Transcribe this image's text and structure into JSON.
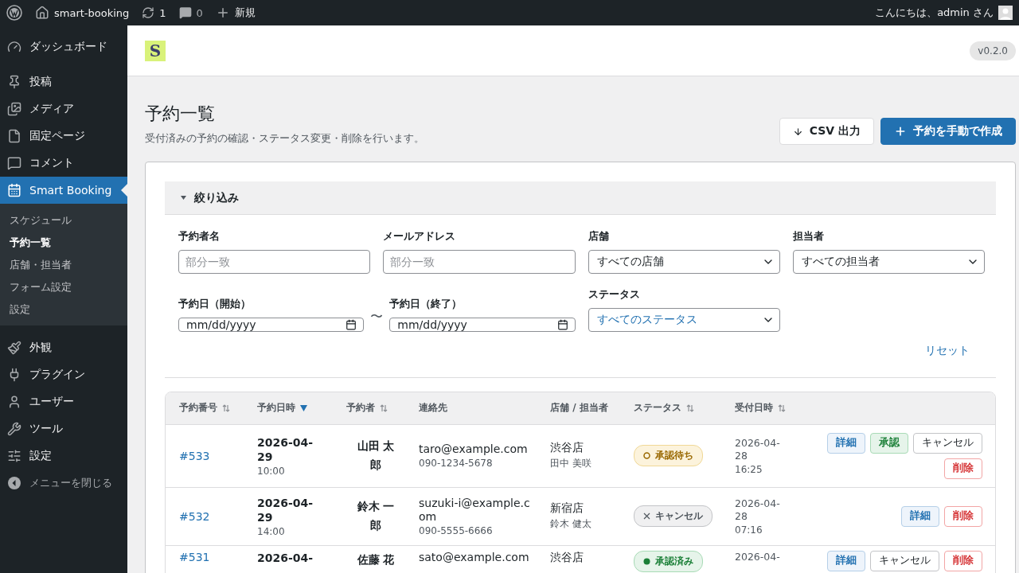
{
  "admin_bar": {
    "site": "smart-booking",
    "updates": "1",
    "comments": "0",
    "new": "新規",
    "greeting": "こんにちは、admin さん"
  },
  "sidebar": {
    "items": [
      {
        "label": "ダッシュボード",
        "selected": false
      },
      {
        "label": "投稿",
        "selected": false
      },
      {
        "label": "メディア",
        "selected": false
      },
      {
        "label": "固定ページ",
        "selected": false
      },
      {
        "label": "コメント",
        "selected": false
      },
      {
        "label": "Smart Booking",
        "selected": true,
        "children": [
          {
            "label": "スケジュール",
            "selected": false
          },
          {
            "label": "予約一覧",
            "selected": true
          },
          {
            "label": "店舗・担当者",
            "selected": false
          },
          {
            "label": "フォーム設定",
            "selected": false
          },
          {
            "label": "設定",
            "selected": false
          }
        ]
      },
      {
        "label": "外観",
        "selected": false
      },
      {
        "label": "プラグイン",
        "selected": false
      },
      {
        "label": "ユーザー",
        "selected": false
      },
      {
        "label": "ツール",
        "selected": false
      },
      {
        "label": "設定",
        "selected": false
      }
    ],
    "collapse": "メニューを閉じる"
  },
  "header": {
    "logo": "S",
    "version": "v0.2.0"
  },
  "page": {
    "title": "予約一覧",
    "subtitle": "受付済みの予約の確認・ステータス変更・削除を行います。",
    "buttons": [
      {
        "label": "CSV 出力",
        "kind": "export"
      },
      {
        "label": "予約を手動で作成",
        "kind": "create"
      }
    ]
  },
  "filter": {
    "title": "絞り込み",
    "expanded": true,
    "fields": [
      {
        "label": "予約者名",
        "kind": "text",
        "placeholder": "部分一致"
      },
      {
        "label": "メールアドレス",
        "kind": "text",
        "placeholder": "部分一致"
      },
      {
        "label": "店舗",
        "kind": "select",
        "value": "すべての店舗",
        "focused": false
      },
      {
        "label": "担当者",
        "kind": "select",
        "value": "すべての担当者",
        "focused": false
      }
    ],
    "date_range": {
      "start": {
        "label": "予約日（開始）",
        "placeholder": "mm/dd/yyyy"
      },
      "separator": "〜",
      "end": {
        "label": "予約日（終了）",
        "placeholder": "mm/dd/yyyy"
      }
    },
    "status": {
      "label": "ステータス",
      "kind": "select",
      "value": "すべてのステータス",
      "focused": true
    },
    "reset": "リセット"
  },
  "table": {
    "columns": [
      {
        "label": "予約番号",
        "sortable": true,
        "sorted": false
      },
      {
        "label": "予約日時",
        "sortable": true,
        "sorted": true
      },
      {
        "label": "予約者",
        "sortable": true,
        "sorted": false
      },
      {
        "label": "連絡先",
        "sortable": false,
        "sorted": false
      },
      {
        "label": "店舗 / 担当者",
        "sortable": false,
        "sorted": false
      },
      {
        "label": "ステータス",
        "sortable": true,
        "sorted": false
      },
      {
        "label": "受付日時",
        "sortable": true,
        "sorted": false
      }
    ],
    "rows": [
      {
        "id": "#533",
        "date": "2026-04-29",
        "time": "10:00",
        "name": "山田 太郎",
        "email": "taro@example.com",
        "phone": "090-1234-5678",
        "store": "渋谷店",
        "staff": "田中 美咲",
        "status": {
          "label": "承認待ち",
          "kind": "pending"
        },
        "received_date": "2026-04-28",
        "received_time": "16:25",
        "actions": [
          {
            "label": "詳細",
            "kind": "detail"
          },
          {
            "label": "承認",
            "kind": "approve"
          },
          {
            "label": "キャンセル",
            "kind": "cancel"
          },
          {
            "label": "削除",
            "kind": "delete"
          }
        ]
      },
      {
        "id": "#532",
        "date": "2026-04-29",
        "time": "14:00",
        "name": "鈴木 一郎",
        "email": "suzuki-i@example.com",
        "phone": "090-5555-6666",
        "store": "新宿店",
        "staff": "鈴木 健太",
        "status": {
          "label": "キャンセル",
          "kind": "cancelled"
        },
        "received_date": "2026-04-28",
        "received_time": "07:16",
        "actions": [
          {
            "label": "詳細",
            "kind": "detail"
          },
          {
            "label": "削除",
            "kind": "delete"
          }
        ]
      },
      {
        "id": "#531",
        "date": "2026-04-",
        "name": "佐藤 花",
        "email": "sato@example.com",
        "store": "渋谷店",
        "status": {
          "label": "承認済み",
          "kind": "approved"
        },
        "received_date": "2026-04-",
        "actions": [
          {
            "label": "詳細",
            "kind": "detail"
          },
          {
            "label": "キャンセル",
            "kind": "cancel"
          },
          {
            "label": "削除",
            "kind": "delete"
          }
        ]
      }
    ]
  }
}
